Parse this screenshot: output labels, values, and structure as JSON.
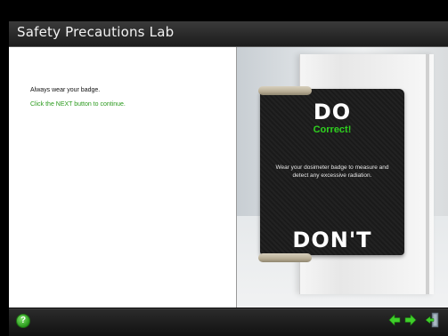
{
  "header": {
    "title": "Safety Precautions Lab"
  },
  "instructions": {
    "line1": "Always wear your badge.",
    "line2": "Click the NEXT button to continue."
  },
  "badge_card": {
    "do_label": "DO",
    "feedback": "Correct!",
    "description": "Wear your dosimeter badge to measure and detect any excessive radiation.",
    "dont_label": "DON'T"
  },
  "footer": {
    "help_label": "?",
    "icons": [
      "help-icon",
      "back-arrow-icon",
      "next-arrow-icon",
      "exit-icon"
    ]
  },
  "colors": {
    "accent_green": "#2fd11f",
    "instruction_green": "#2a9a1c",
    "badge_black": "#1b1b1b"
  }
}
